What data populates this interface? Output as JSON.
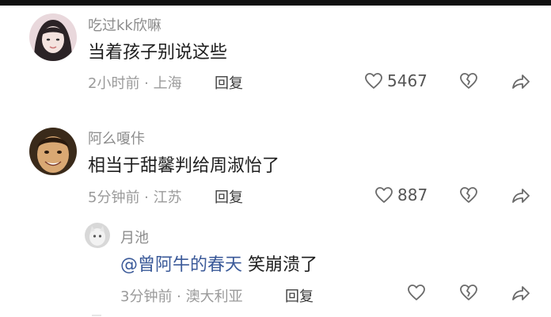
{
  "comments": [
    {
      "username": "吃过kk欣嘛",
      "text": "当着孩子别说这些",
      "meta": "2小时前 · 上海",
      "reply_label": "回复",
      "likes": "5467"
    },
    {
      "username": "阿么嗄佧",
      "text": "相当于甜馨判给周淑怡了",
      "meta": "5分钟前 · 江苏",
      "reply_label": "回复",
      "likes": "887"
    }
  ],
  "reply": {
    "username": "月池",
    "mention": "@曾阿牛的春天",
    "text": " 笑崩溃了",
    "meta": "3分钟前 · 澳大利亚",
    "reply_label": "回复"
  },
  "icons": {
    "like": "heart-outline-icon",
    "dislike": "broken-heart-icon",
    "share": "share-arrow-icon"
  },
  "colors": {
    "mention": "#3b5a99",
    "meta": "#9a9a9a",
    "username": "#8c8c8c"
  }
}
